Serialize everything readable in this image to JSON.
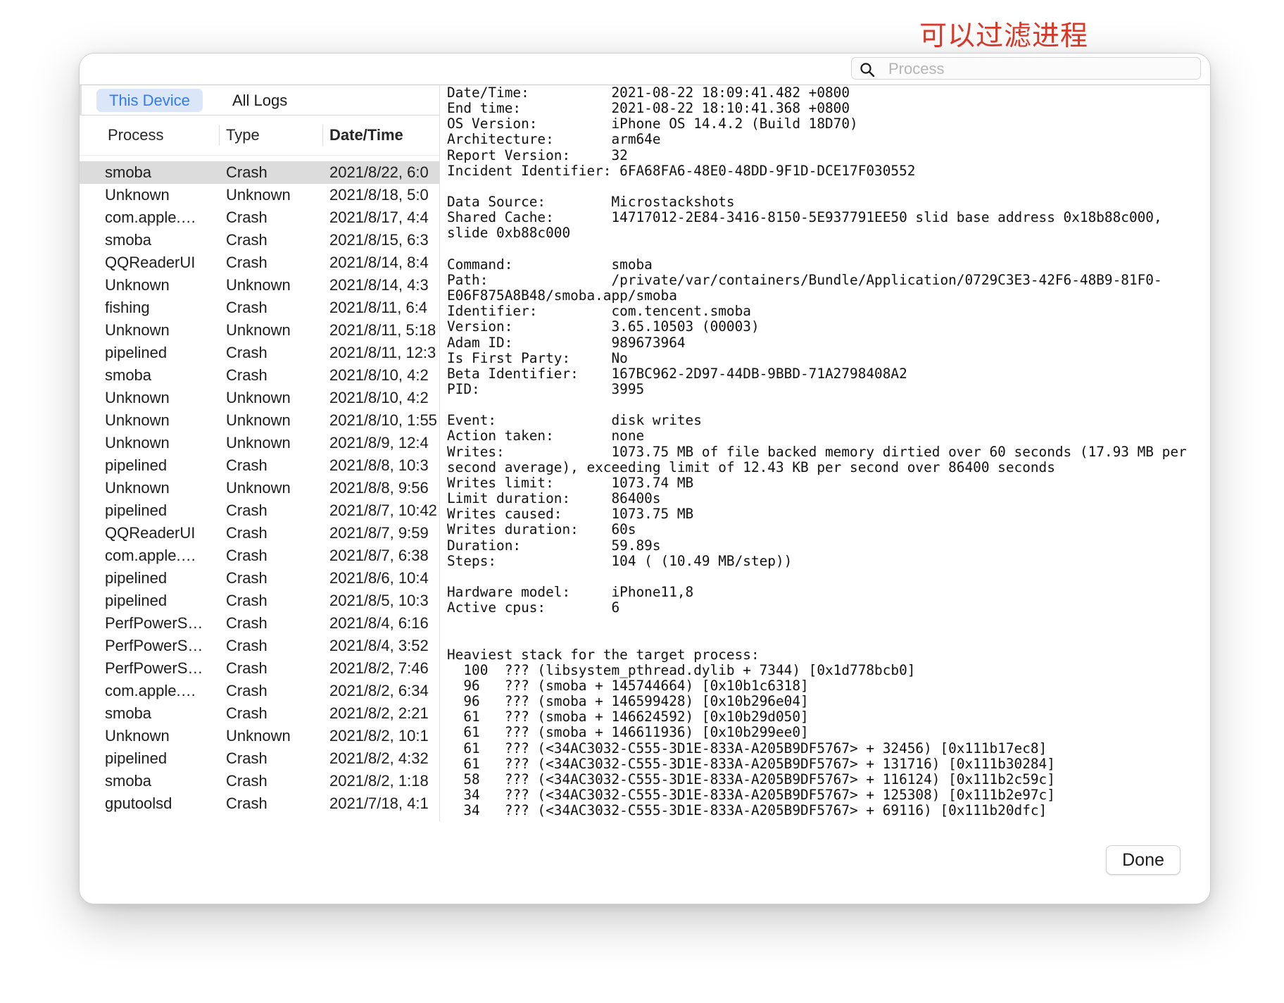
{
  "annotation": "可以过滤进程",
  "search": {
    "placeholder": "Process",
    "value": ""
  },
  "segments": {
    "this_device": "This Device",
    "all_logs": "All Logs",
    "selected": "This Device"
  },
  "columns": {
    "process": "Process",
    "type": "Type",
    "date": "Date/Time"
  },
  "rows": [
    {
      "process": "smoba",
      "type": "Crash",
      "date": "2021/8/22, 6:0",
      "selected": true
    },
    {
      "process": "Unknown",
      "type": "Unknown",
      "date": "2021/8/18, 5:0"
    },
    {
      "process": "com.apple.W...",
      "type": "Crash",
      "date": "2021/8/17, 4:4"
    },
    {
      "process": "smoba",
      "type": "Crash",
      "date": "2021/8/15, 6:3"
    },
    {
      "process": "QQReaderUI",
      "type": "Crash",
      "date": "2021/8/14, 8:4"
    },
    {
      "process": "Unknown",
      "type": "Unknown",
      "date": "2021/8/14, 4:3"
    },
    {
      "process": "fishing",
      "type": "Crash",
      "date": "2021/8/11, 6:4"
    },
    {
      "process": "Unknown",
      "type": "Unknown",
      "date": "2021/8/11, 5:18"
    },
    {
      "process": "pipelined",
      "type": "Crash",
      "date": "2021/8/11, 12:3"
    },
    {
      "process": "smoba",
      "type": "Crash",
      "date": "2021/8/10, 4:2"
    },
    {
      "process": "Unknown",
      "type": "Unknown",
      "date": "2021/8/10, 4:2"
    },
    {
      "process": "Unknown",
      "type": "Unknown",
      "date": "2021/8/10, 1:55"
    },
    {
      "process": "Unknown",
      "type": "Unknown",
      "date": "2021/8/9, 12:4"
    },
    {
      "process": "pipelined",
      "type": "Crash",
      "date": "2021/8/8, 10:3"
    },
    {
      "process": "Unknown",
      "type": "Unknown",
      "date": "2021/8/8, 9:56"
    },
    {
      "process": "pipelined",
      "type": "Crash",
      "date": "2021/8/7, 10:42"
    },
    {
      "process": "QQReaderUI",
      "type": "Crash",
      "date": "2021/8/7, 9:59"
    },
    {
      "process": "com.apple.W...",
      "type": "Crash",
      "date": "2021/8/7, 6:38"
    },
    {
      "process": "pipelined",
      "type": "Crash",
      "date": "2021/8/6, 10:4"
    },
    {
      "process": "pipelined",
      "type": "Crash",
      "date": "2021/8/5, 10:3"
    },
    {
      "process": "PerfPowerSe...",
      "type": "Crash",
      "date": "2021/8/4, 6:16"
    },
    {
      "process": "PerfPowerSe...",
      "type": "Crash",
      "date": "2021/8/4, 3:52"
    },
    {
      "process": "PerfPowerSe...",
      "type": "Crash",
      "date": "2021/8/2, 7:46"
    },
    {
      "process": "com.apple.W...",
      "type": "Crash",
      "date": "2021/8/2, 6:34"
    },
    {
      "process": "smoba",
      "type": "Crash",
      "date": "2021/8/2, 2:21"
    },
    {
      "process": "Unknown",
      "type": "Unknown",
      "date": "2021/8/2, 10:1"
    },
    {
      "process": "pipelined",
      "type": "Crash",
      "date": "2021/8/2, 4:32"
    },
    {
      "process": "smoba",
      "type": "Crash",
      "date": "2021/8/2, 1:18"
    },
    {
      "process": "gputoolsd",
      "type": "Crash",
      "date": "2021/7/18, 4:1"
    }
  ],
  "report_lines": [
    "Date/Time:          2021-08-22 18:09:41.482 +0800",
    "End time:           2021-08-22 18:10:41.368 +0800",
    "OS Version:         iPhone OS 14.4.2 (Build 18D70)",
    "Architecture:       arm64e",
    "Report Version:     32",
    "Incident Identifier: 6FA68FA6-48E0-48DD-9F1D-DCE17F030552",
    "",
    "Data Source:        Microstackshots",
    "Shared Cache:       14717012-2E84-3416-8150-5E937791EE50 slid base address 0x18b88c000,",
    "slide 0xb88c000",
    "",
    "Command:            smoba",
    "Path:               /private/var/containers/Bundle/Application/0729C3E3-42F6-48B9-81F0-",
    "E06F875A8B48/smoba.app/smoba",
    "Identifier:         com.tencent.smoba",
    "Version:            3.65.10503 (00003)",
    "Adam ID:            989673964",
    "Is First Party:     No",
    "Beta Identifier:    167BC962-2D97-44DB-9BBD-71A2798408A2",
    "PID:                3995",
    "",
    "Event:              disk writes",
    "Action taken:       none",
    "Writes:             1073.75 MB of file backed memory dirtied over 60 seconds (17.93 MB per",
    "second average), exceeding limit of 12.43 KB per second over 86400 seconds",
    "Writes limit:       1073.74 MB",
    "Limit duration:     86400s",
    "Writes caused:      1073.75 MB",
    "Writes duration:    60s",
    "Duration:           59.89s",
    "Steps:              104 ( (10.49 MB/step))",
    "",
    "Hardware model:     iPhone11,8",
    "Active cpus:        6",
    "",
    "",
    "Heaviest stack for the target process:",
    "  100  ??? (libsystem_pthread.dylib + 7344) [0x1d778bcb0]",
    "  96   ??? (smoba + 145744664) [0x10b1c6318]",
    "  96   ??? (smoba + 146599428) [0x10b296e04]",
    "  61   ??? (smoba + 146624592) [0x10b29d050]",
    "  61   ??? (smoba + 146611936) [0x10b299ee0]",
    "  61   ??? (<34AC3032-C555-3D1E-833A-A205B9DF5767> + 32456) [0x111b17ec8]",
    "  61   ??? (<34AC3032-C555-3D1E-833A-A205B9DF5767> + 131716) [0x111b30284]",
    "  58   ??? (<34AC3032-C555-3D1E-833A-A205B9DF5767> + 116124) [0x111b2c59c]",
    "  34   ??? (<34AC3032-C555-3D1E-833A-A205B9DF5767> + 125308) [0x111b2e97c]",
    "  34   ??? (<34AC3032-C555-3D1E-833A-A205B9DF5767> + 69116) [0x111b20dfc]"
  ],
  "done_label": "Done"
}
